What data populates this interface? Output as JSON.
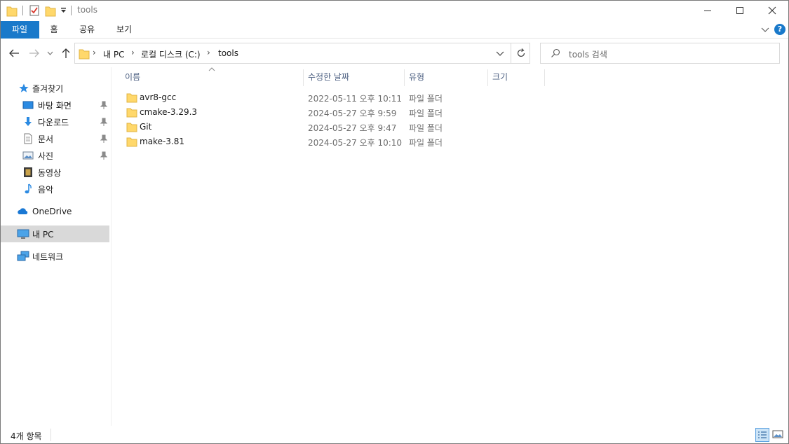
{
  "window": {
    "title": "tools",
    "controls": {
      "minimize": "—",
      "maximize": "☐",
      "close": "✕"
    }
  },
  "ribbon": {
    "tabs": [
      "파일",
      "홈",
      "공유",
      "보기"
    ],
    "help": "?"
  },
  "address": {
    "crumbs": [
      "내 PC",
      "로컬 디스크 (C:)",
      "tools"
    ],
    "separator": "›"
  },
  "search": {
    "placeholder": "tools 검색"
  },
  "nav": {
    "quick_access": "즐겨찾기",
    "items": [
      {
        "label": "바탕 화면",
        "icon": "desktop-icon",
        "pinned": true
      },
      {
        "label": "다운로드",
        "icon": "download-icon",
        "pinned": true
      },
      {
        "label": "문서",
        "icon": "document-icon",
        "pinned": true
      },
      {
        "label": "사진",
        "icon": "pictures-icon",
        "pinned": true
      },
      {
        "label": "동영상",
        "icon": "video-icon",
        "pinned": false
      },
      {
        "label": "음악",
        "icon": "music-icon",
        "pinned": false
      }
    ],
    "onedrive": "OneDrive",
    "this_pc": "내 PC",
    "network": "네트워크"
  },
  "columns": {
    "name": "이름",
    "date": "수정한 날짜",
    "type": "유형",
    "size": "크기"
  },
  "files": [
    {
      "name": "avr8-gcc",
      "date": "2022-05-11 오후 10:11",
      "type": "파일 폴더"
    },
    {
      "name": "cmake-3.29.3",
      "date": "2024-05-27 오후 9:59",
      "type": "파일 폴더"
    },
    {
      "name": "Git",
      "date": "2024-05-27 오후 9:47",
      "type": "파일 폴더"
    },
    {
      "name": "make-3.81",
      "date": "2024-05-27 오후 10:10",
      "type": "파일 폴더"
    }
  ],
  "status": {
    "item_count": "4개 항목"
  },
  "colors": {
    "accent": "#1979ca",
    "folder": "#ffd86b",
    "selected_bg": "#d9d9d9"
  }
}
